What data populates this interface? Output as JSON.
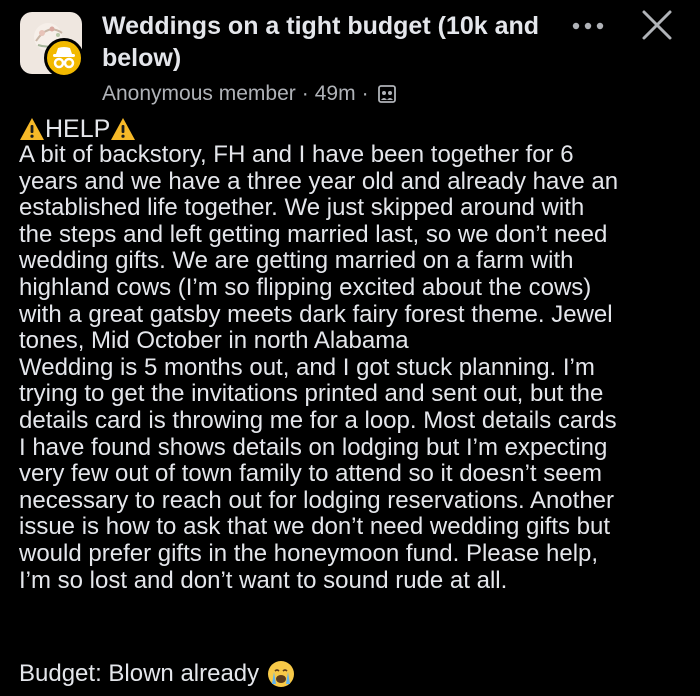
{
  "header": {
    "group_name": "Weddings on a tight budget (10k and below)",
    "author": "Anonymous member",
    "time_ago": "49m",
    "separator": "·",
    "audience_icon": "group-audience-icon",
    "more_icon": "more-options-icon",
    "close_icon": "close-icon",
    "anon_badge_icon": "anonymous-incognito-icon",
    "anon_badge_color": "#f2b900"
  },
  "post": {
    "help_label": "HELP",
    "help_icon": "warning-icon",
    "body": "A bit of backstory, FH and I have been together for 6\nyears and we have a three year old and already have an\nestablished life together. We just skipped around with\nthe steps and left getting married last, so we don’t need\nwedding gifts. We are getting married on a farm with\nhighland cows (I’m so flipping excited about the cows)\nwith a great gatsby meets dark fairy forest theme. Jewel\ntones, Mid October in north Alabama\nWedding is 5 months out, and I got stuck planning. I’m\ntrying to get the invitations printed and sent out, but the\ndetails card is throwing me for a loop. Most details cards\nI have found shows details on lodging but I’m expecting\nvery few out of town family to attend so it doesn’t seem\nnecessary to reach out for lodging reservations. Another\nissue is how to ask that we don’t need wedding gifts but\nwould prefer gifts in the honeymoon fund. Please help,\nI’m so lost and don’t want to sound rude at all.",
    "budget": "Budget: Blown already",
    "budget_emoji": "crying-face-icon"
  },
  "colors": {
    "background": "#000000",
    "text": "#e4e6eb",
    "secondary_text": "#b0b3b8",
    "warning": "#f7b928"
  }
}
